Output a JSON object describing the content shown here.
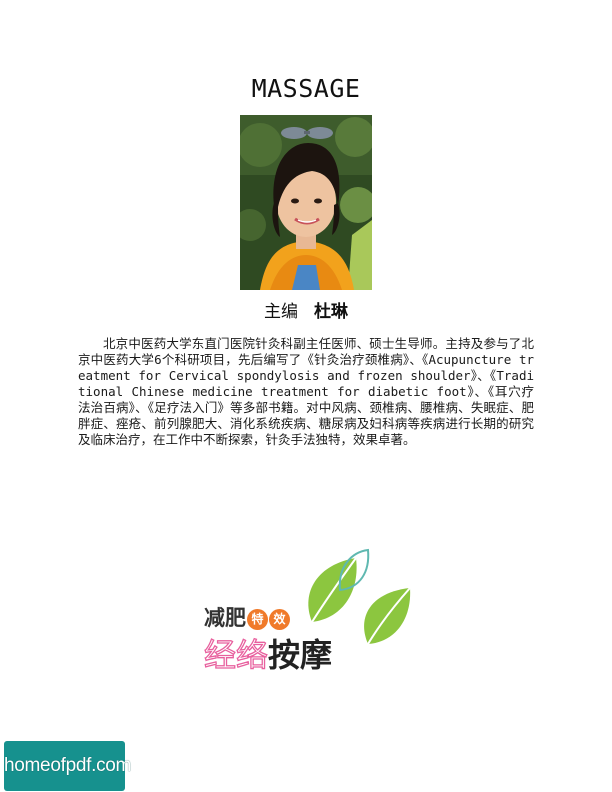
{
  "page": {
    "title": "MASSAGE"
  },
  "byline": {
    "role": "主编",
    "author": "杜琳"
  },
  "bio": {
    "text": "北京中医药大学东直门医院针灸科副主任医师、硕士生导师。主持及参与了北京中医药大学6个科研项目，先后编写了《针灸治疗颈椎病》、《Acupuncture treatment for Cervical spondylosis and frozen shoulder》、《Traditional Chinese medicine treatment for diabetic foot》、《耳穴疗法治百病》、《足疗法入门》等多部书籍。对中风病、颈椎病、腰椎病、失眠症、肥胖症、痤疮、前列腺肥大、消化系统疾病、糖尿病及妇科病等疾病进行长期的研究及临床治疗，在工作中不断探索，针灸手法独特，效果卓著。"
  },
  "logo": {
    "line1": "减肥",
    "badge1": "特",
    "badge2": "效",
    "line2_pink": "经络",
    "line2_dark": "按摩"
  },
  "watermark": {
    "text": "homeofpdf.com"
  },
  "colors": {
    "leaf_green": "#8cc63f",
    "leaf_outline": "#5fb8b0",
    "badge_orange": "#f07a2a",
    "logo_pink": "#e8609e",
    "watermark_teal": "#16918e",
    "scarf_orange": "#f2a21c"
  }
}
